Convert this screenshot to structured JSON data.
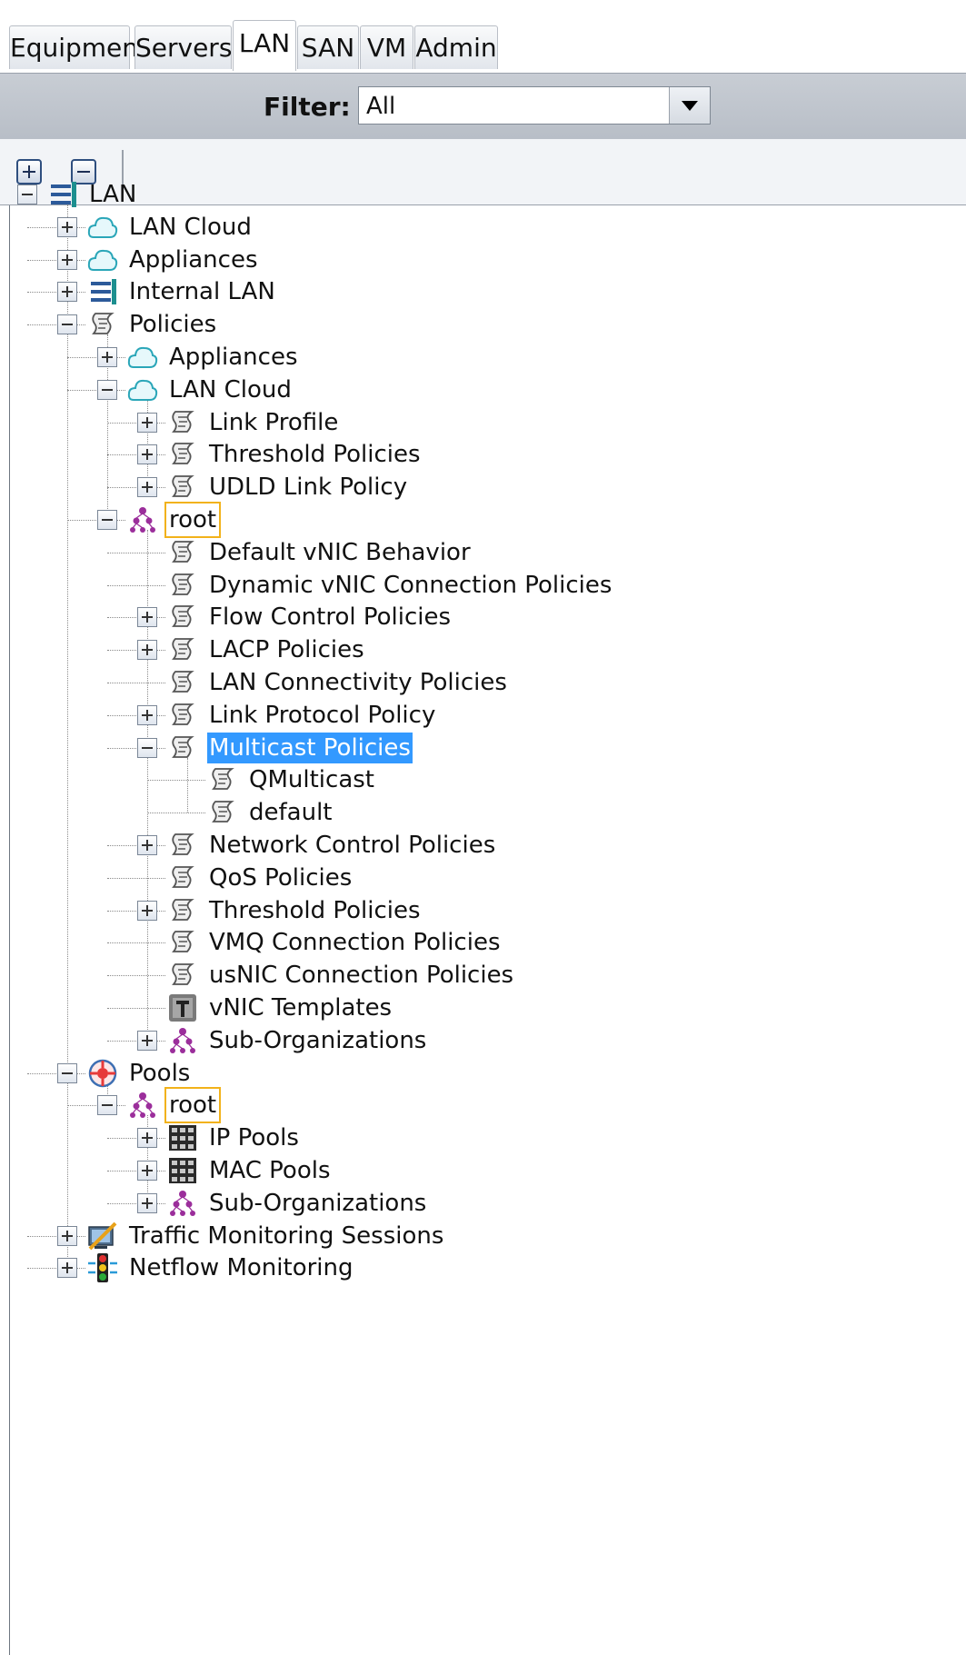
{
  "tabs": [
    {
      "label": "Equipment",
      "active": false
    },
    {
      "label": "Servers",
      "active": false
    },
    {
      "label": "LAN",
      "active": true
    },
    {
      "label": "SAN",
      "active": false
    },
    {
      "label": "VM",
      "active": false
    },
    {
      "label": "Admin",
      "active": false
    }
  ],
  "filter": {
    "label": "Filter:",
    "value": "All"
  },
  "toolbar": {
    "expand_all": "expand-all",
    "collapse_all": "collapse-all"
  },
  "colors": {
    "selection": "#3399ff",
    "org_highlight": "#f2b21a",
    "filter_bar": "#c0c5cc"
  },
  "tree": [
    {
      "label": "LAN",
      "depth": 0,
      "icon": "lan-icon",
      "expander": "expanded"
    },
    {
      "label": "LAN Cloud",
      "depth": 1,
      "icon": "cloud-icon",
      "expander": "collapsed"
    },
    {
      "label": "Appliances",
      "depth": 1,
      "icon": "cloud-icon",
      "expander": "collapsed"
    },
    {
      "label": "Internal LAN",
      "depth": 1,
      "icon": "lan-icon",
      "expander": "collapsed"
    },
    {
      "label": "Policies",
      "depth": 1,
      "icon": "policy-icon",
      "expander": "expanded"
    },
    {
      "label": "Appliances",
      "depth": 2,
      "icon": "cloud-icon",
      "expander": "collapsed"
    },
    {
      "label": "LAN Cloud",
      "depth": 2,
      "icon": "cloud-icon",
      "expander": "expanded"
    },
    {
      "label": "Link Profile",
      "depth": 3,
      "icon": "policy-icon",
      "expander": "collapsed"
    },
    {
      "label": "Threshold Policies",
      "depth": 3,
      "icon": "policy-icon",
      "expander": "collapsed"
    },
    {
      "label": "UDLD Link Policy",
      "depth": 3,
      "icon": "policy-icon",
      "expander": "collapsed"
    },
    {
      "label": "root",
      "depth": 2,
      "icon": "org-icon",
      "expander": "expanded",
      "boxed": true
    },
    {
      "label": "Default vNIC Behavior",
      "depth": 3,
      "icon": "policy-icon",
      "expander": "none"
    },
    {
      "label": "Dynamic vNIC Connection Policies",
      "depth": 3,
      "icon": "policy-icon",
      "expander": "none"
    },
    {
      "label": "Flow Control Policies",
      "depth": 3,
      "icon": "policy-icon",
      "expander": "collapsed"
    },
    {
      "label": "LACP Policies",
      "depth": 3,
      "icon": "policy-icon",
      "expander": "collapsed"
    },
    {
      "label": "LAN Connectivity Policies",
      "depth": 3,
      "icon": "policy-icon",
      "expander": "none"
    },
    {
      "label": "Link Protocol Policy",
      "depth": 3,
      "icon": "policy-icon",
      "expander": "collapsed"
    },
    {
      "label": "Multicast Policies",
      "depth": 3,
      "icon": "policy-icon",
      "expander": "expanded",
      "selected": true
    },
    {
      "label": "QMulticast",
      "depth": 4,
      "icon": "policy-icon",
      "expander": "none"
    },
    {
      "label": "default",
      "depth": 4,
      "icon": "policy-icon",
      "expander": "none"
    },
    {
      "label": "Network Control Policies",
      "depth": 3,
      "icon": "policy-icon",
      "expander": "collapsed"
    },
    {
      "label": "QoS Policies",
      "depth": 3,
      "icon": "policy-icon",
      "expander": "none"
    },
    {
      "label": "Threshold Policies",
      "depth": 3,
      "icon": "policy-icon",
      "expander": "collapsed"
    },
    {
      "label": "VMQ Connection Policies",
      "depth": 3,
      "icon": "policy-icon",
      "expander": "none"
    },
    {
      "label": "usNIC Connection Policies",
      "depth": 3,
      "icon": "policy-icon",
      "expander": "none"
    },
    {
      "label": "vNIC Templates",
      "depth": 3,
      "icon": "template-icon",
      "expander": "none"
    },
    {
      "label": "Sub-Organizations",
      "depth": 3,
      "icon": "org-icon",
      "expander": "collapsed"
    },
    {
      "label": "Pools",
      "depth": 1,
      "icon": "pools-icon",
      "expander": "expanded"
    },
    {
      "label": "root",
      "depth": 2,
      "icon": "org-icon",
      "expander": "expanded",
      "boxed": true
    },
    {
      "label": "IP Pools",
      "depth": 3,
      "icon": "pool-grid-icon",
      "expander": "collapsed"
    },
    {
      "label": "MAC Pools",
      "depth": 3,
      "icon": "pool-grid-icon",
      "expander": "collapsed"
    },
    {
      "label": "Sub-Organizations",
      "depth": 3,
      "icon": "org-icon",
      "expander": "collapsed"
    },
    {
      "label": "Traffic Monitoring Sessions",
      "depth": 1,
      "icon": "monitor-icon",
      "expander": "collapsed"
    },
    {
      "label": "Netflow Monitoring",
      "depth": 1,
      "icon": "netflow-icon",
      "expander": "collapsed"
    }
  ]
}
